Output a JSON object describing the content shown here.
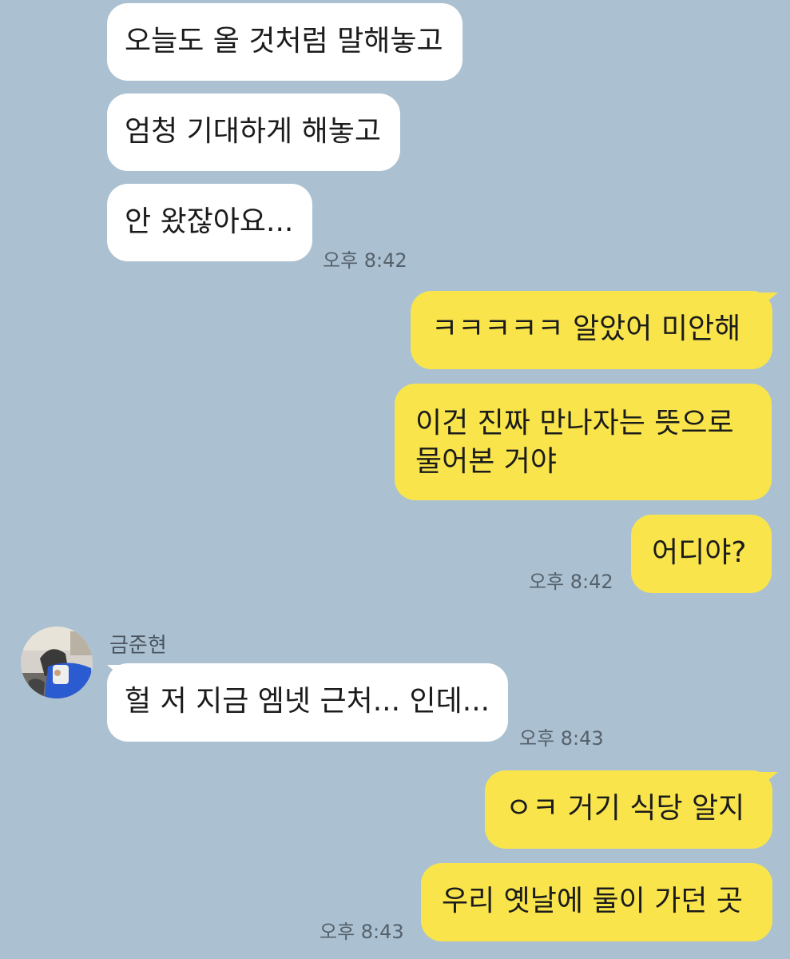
{
  "conversation": {
    "contact_name": "금준현",
    "messages": [
      {
        "from": "them",
        "text": "오늘도 올 것처럼 말해놓고"
      },
      {
        "from": "them",
        "text": "엄청 기대하게 해놓고"
      },
      {
        "from": "them",
        "text": "안 왔잖아요...",
        "time": "오후 8:42"
      },
      {
        "from": "me",
        "text": "ㅋㅋㅋㅋㅋ 알았어 미안해"
      },
      {
        "from": "me",
        "text": "이건 진짜 만나자는 뜻으로 물어본 거야"
      },
      {
        "from": "me",
        "text": "어디야?",
        "time": "오후 8:42"
      },
      {
        "from": "them",
        "text": "헐 저 지금 엠넷 근처... 인데...",
        "time": "오후 8:43"
      },
      {
        "from": "me",
        "text": "ㅇㅋ 거기 식당 알지"
      },
      {
        "from": "me",
        "text": "우리 옛날에 둘이 가던 곳",
        "time": "오후 8:43"
      }
    ]
  },
  "colors": {
    "background": "#abc1d1",
    "incoming_bubble": "#ffffff",
    "outgoing_bubble": "#f9e54b",
    "timestamp_text": "#55606b"
  },
  "icons": {
    "avatar": "profile-photo"
  }
}
